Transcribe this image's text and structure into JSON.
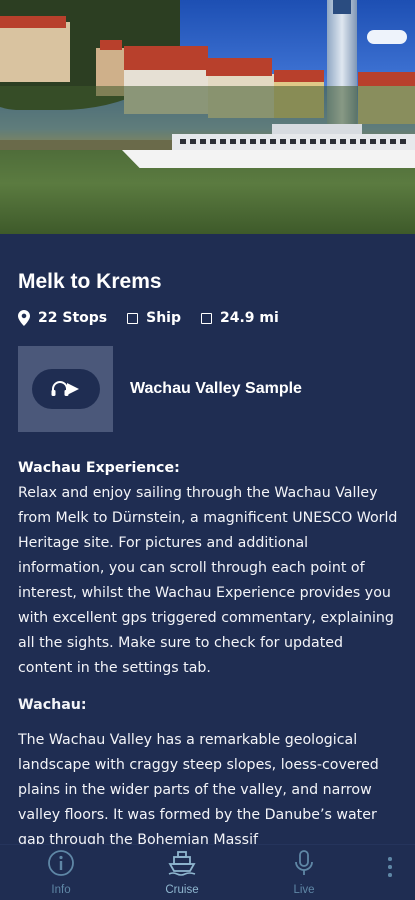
{
  "route": {
    "title": "Melk to Krems",
    "stops": "22 Stops",
    "vessel": "Ship",
    "distance": "24.9 mi"
  },
  "audio": {
    "label": "Wachau Valley Sample",
    "icon": "headphones-play-icon"
  },
  "sections": [
    {
      "heading": "Wachau Experience:",
      "text": "Relax and enjoy sailing through the Wachau Valley from Melk to Dürnstein, a magnificent UNESCO World Heritage site. For pictures and additional information, you can scroll through each point of interest, whilst the Wachau Experience provides you with excellent gps triggered commentary, explaining all the sights. Make sure to check for updated content in the settings tab."
    },
    {
      "heading": "Wachau:",
      "text": "The Wachau Valley has a remarkable geological landscape with craggy steep slopes, loess-covered plains in the wider parts of the valley, and narrow valley floors. It was formed by the Danube’s water gap through the Bohemian Massif"
    }
  ],
  "nav": {
    "tabs": [
      {
        "label": "Info",
        "icon": "info-icon"
      },
      {
        "label": "Cruise",
        "icon": "ship-icon"
      },
      {
        "label": "Live",
        "icon": "microphone-icon"
      }
    ],
    "more_icon": "more-vertical-icon"
  },
  "colors": {
    "background": "#1f2d52",
    "thumb": "#4b587a",
    "nav_icon": "#5f87a6"
  }
}
